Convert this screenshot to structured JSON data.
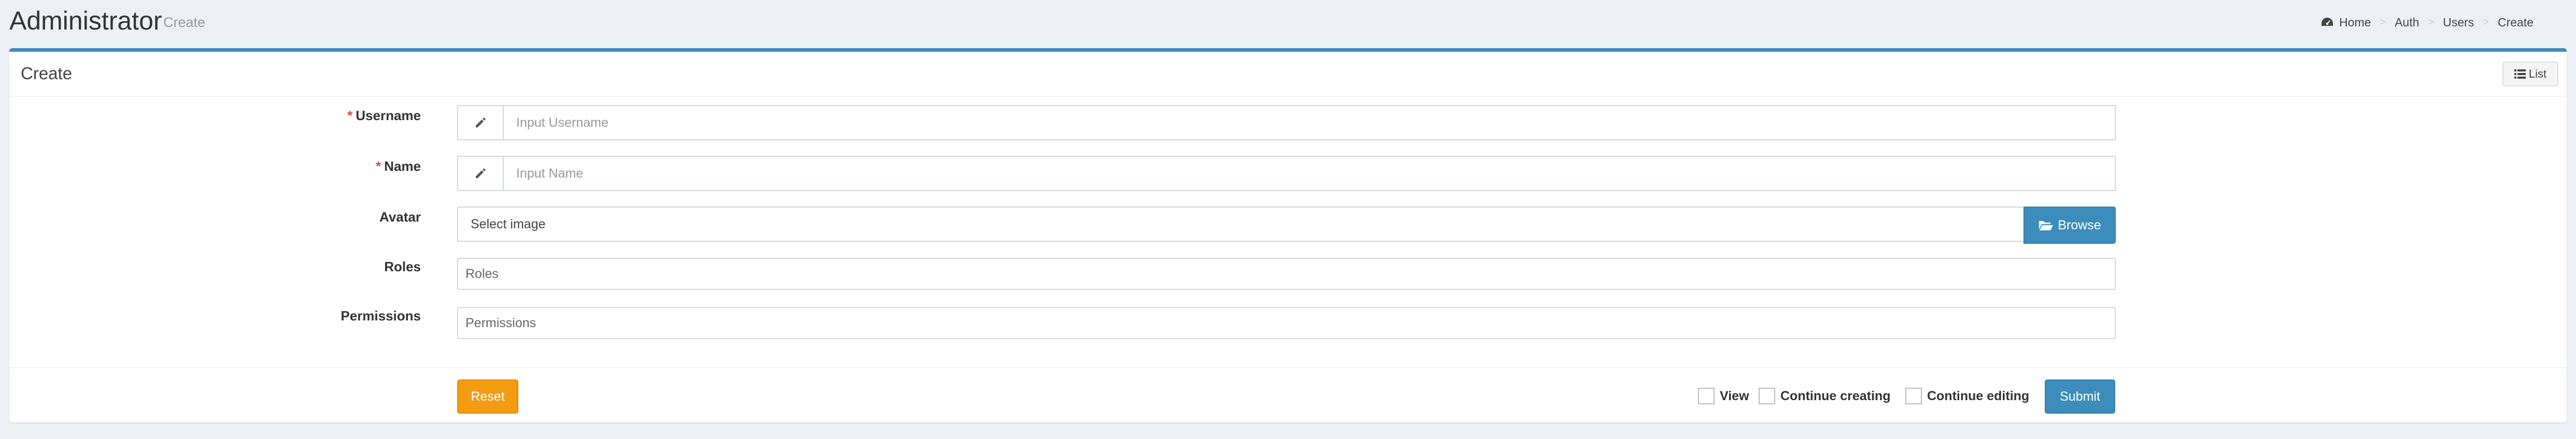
{
  "header": {
    "title": "Administrator",
    "subtitle": "Create",
    "breadcrumb": [
      "Home",
      "Auth",
      "Users",
      "Create"
    ]
  },
  "box": {
    "title": "Create",
    "list_button": "List"
  },
  "form": {
    "username": {
      "label": "Username",
      "required_mark": "*",
      "placeholder": "Input Username",
      "icon": "pencil-icon"
    },
    "name": {
      "label": "Name",
      "required_mark": "*",
      "placeholder": "Input Name",
      "icon": "pencil-icon"
    },
    "avatar": {
      "label": "Avatar",
      "placeholder": "Select image",
      "browse_label": "Browse",
      "icon": "folder-open-icon"
    },
    "roles": {
      "label": "Roles",
      "placeholder": "Roles"
    },
    "permissions": {
      "label": "Permissions",
      "placeholder": "Permissions"
    }
  },
  "footer": {
    "reset_label": "Reset",
    "checkboxes": [
      "View",
      "Continue creating",
      "Continue editing"
    ],
    "submit_label": "Submit"
  },
  "colors": {
    "primary": "#3c8dbc",
    "warning": "#f39c12",
    "required": "#dd4b39",
    "background": "#ecf0f5"
  }
}
